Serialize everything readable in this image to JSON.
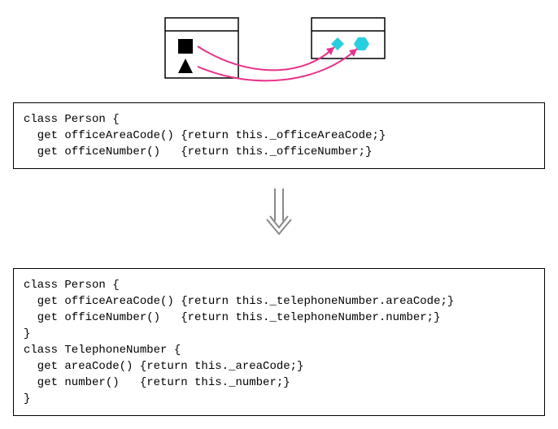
{
  "code_before": "class Person {\n  get officeAreaCode() {return this._officeAreaCode;}\n  get officeNumber()   {return this._officeNumber;}",
  "code_after": "class Person {\n  get officeAreaCode() {return this._telephoneNumber.areaCode;}\n  get officeNumber()   {return this._telephoneNumber.number;}\n}\nclass TelephoneNumber {\n  get areaCode() {return this._areaCode;}\n  get number()   {return this._number;}\n}"
}
